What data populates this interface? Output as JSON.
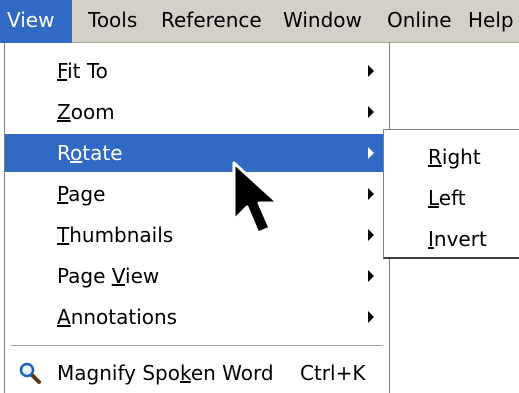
{
  "menubar": {
    "items": [
      {
        "label": "View",
        "active": true
      },
      {
        "label": "Tools"
      },
      {
        "label": "Reference"
      },
      {
        "label": "Window"
      },
      {
        "label": "Online"
      },
      {
        "label": "Help"
      }
    ]
  },
  "view_menu": {
    "items": [
      {
        "label": "Fit To",
        "mnemonic": "F",
        "has_submenu": true
      },
      {
        "label": "Zoom",
        "mnemonic": "Z",
        "has_submenu": true
      },
      {
        "label": "Rotate",
        "mnemonic": "o",
        "has_submenu": true,
        "highlighted": true
      },
      {
        "label": "Page",
        "mnemonic": "P",
        "has_submenu": true
      },
      {
        "label": "Thumbnails",
        "mnemonic": "T",
        "has_submenu": true
      },
      {
        "label": "Page View",
        "mnemonic": "V",
        "has_submenu": true
      },
      {
        "label": "Annotations",
        "mnemonic": "A",
        "has_submenu": true
      }
    ],
    "magnify": {
      "label": "Magnify Spoken Word",
      "mnemonic": "k",
      "shortcut": "Ctrl+K",
      "icon": "magnifier-icon"
    }
  },
  "rotate_submenu": {
    "items": [
      {
        "label": "Right",
        "mnemonic": "R"
      },
      {
        "label": "Left",
        "mnemonic": "L"
      },
      {
        "label": "Invert",
        "mnemonic": "I"
      }
    ]
  },
  "colors": {
    "menubar_bg": "#d4d0c8",
    "highlight": "#316ac5",
    "highlight_text": "#ffffff",
    "menu_bg": "#ffffff"
  }
}
